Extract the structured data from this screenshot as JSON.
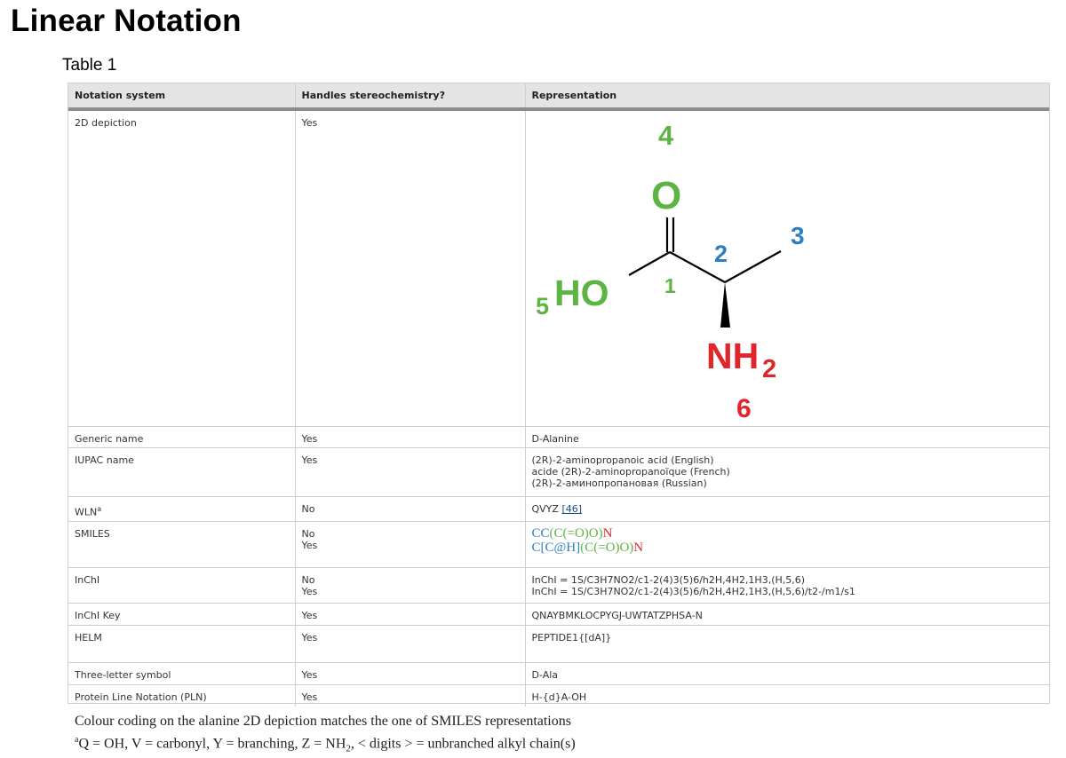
{
  "page": {
    "title": "Linear Notation",
    "table_caption": "Table 1"
  },
  "table": {
    "headers": [
      "Notation system",
      "Handles stereochemistry?",
      "Representation"
    ],
    "rows": {
      "depiction": {
        "system": "2D depiction",
        "stereo": "Yes"
      },
      "generic": {
        "system": "Generic name",
        "stereo": "Yes",
        "repr_prefix": "D",
        "repr": "-Alanine"
      },
      "iupac": {
        "system": "IUPAC name",
        "stereo": "Yes",
        "repr_lines": [
          "(2R)-2-aminopropanoic acid (English)",
          "acide (2R)-2-aminopropanoïque (French)",
          "(2R)-2-аминопропановая (Russian)"
        ]
      },
      "wln": {
        "system": "WLN",
        "system_sup": "a",
        "stereo": "No",
        "repr": "QVYZ ",
        "ref": "[46]"
      },
      "smiles": {
        "system": "SMILES",
        "stereo_lines": [
          "No",
          "Yes"
        ],
        "line1_blue": "CC",
        "line1_green": "(C(=O)O)",
        "line1_red": "N",
        "line2_blue": "C[C@H]",
        "line2_green": "(C(=O)O)",
        "line2_red": "N"
      },
      "inchi": {
        "system": "InChI",
        "stereo_lines": [
          "No",
          "Yes"
        ],
        "repr_lines": [
          "InChI = 1S/C3H7NO2/c1-2(4)3(5)6/h2H,4H2,1H3,(H,5,6)",
          "InChI = 1S/C3H7NO2/c1-2(4)3(5)6/h2H,4H2,1H3,(H,5,6)/t2-/m1/s1"
        ]
      },
      "inchikey": {
        "system": "InChI Key",
        "stereo": "Yes",
        "repr": "QNAYBMKLOCPYGJ-UWTATZPHSA-N"
      },
      "helm": {
        "system": "HELM",
        "stereo": "Yes",
        "repr": "PEPTIDE1{[dA]}"
      },
      "three_letter": {
        "system": "Three-letter symbol",
        "stereo": "Yes",
        "repr": "D-Ala"
      },
      "pln": {
        "system": "Protein Line Notation (PLN)",
        "stereo": "Yes",
        "repr": "H-{d}A-OH"
      }
    }
  },
  "molecule": {
    "label_4": "4",
    "label_O": "O",
    "label_3": "3",
    "label_2": "2",
    "label_1": "1",
    "label_5": "5",
    "label_HO": "HO",
    "label_NH": "NH",
    "label_sub2": "2",
    "label_6": "6",
    "colors": {
      "green": "#5bb443",
      "blue": "#2d7fc1",
      "red": "#e0262b"
    }
  },
  "footnotes": {
    "colour_note": "Colour coding on the alanine 2D depiction matches the one of SMILES representations",
    "wln_sup": "a",
    "wln_pre": "Q = OH, V = carbonyl, Y = branching, Z = NH",
    "wln_sub": "2",
    "wln_post": ", < digits > = unbranched alkyl chain(s)"
  }
}
